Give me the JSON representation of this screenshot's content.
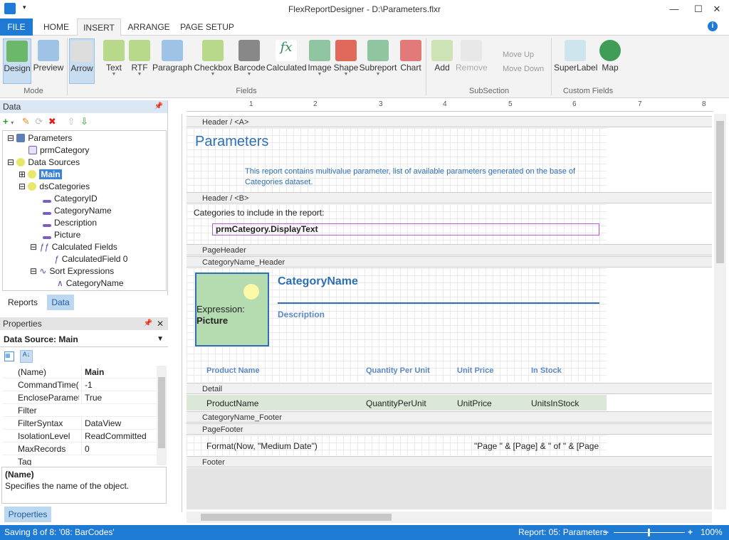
{
  "app": {
    "title": "FlexReportDesigner - D:\\Parameters.flxr"
  },
  "tabs": [
    "FILE",
    "HOME",
    "INSERT",
    "ARRANGE",
    "PAGE SETUP"
  ],
  "ribbon": {
    "mode": [
      "Design",
      "Preview"
    ],
    "fields": [
      "Arrow",
      "Text",
      "RTF",
      "Paragraph",
      "Checkbox",
      "Barcode",
      "Calculated",
      "Image",
      "Shape",
      "Subreport",
      "Chart"
    ],
    "subsection": [
      "Add",
      "Remove",
      "Move Up",
      "Move Down"
    ],
    "custom": [
      "SuperLabel",
      "Map"
    ],
    "groups": {
      "mode": "Mode",
      "fields": "Fields",
      "subsection": "SubSection",
      "custom": "Custom Fields"
    }
  },
  "datapanel": {
    "title": "Data",
    "tree": [
      "Parameters",
      "prmCategory",
      "Data Sources",
      "Main",
      "dsCategories",
      "CategoryID",
      "CategoryName",
      "Description",
      "Picture",
      "Calculated Fields",
      "CalculatedField 0",
      "Sort Expressions",
      "CategoryName"
    ]
  },
  "paneltabs": [
    "Reports",
    "Data"
  ],
  "properties": {
    "title": "Properties",
    "object": "Data Source: Main",
    "rows": [
      [
        "(Name)",
        "Main"
      ],
      [
        "CommandTime(",
        "-1"
      ],
      [
        "EncloseParamete",
        "True"
      ],
      [
        "Filter",
        ""
      ],
      [
        "FilterSyntax",
        "DataView"
      ],
      [
        "IsolationLevel",
        "ReadCommitted"
      ],
      [
        "MaxRecords",
        "0"
      ],
      [
        "Tag",
        ""
      ]
    ],
    "desc_title": "(Name)",
    "desc_text": "Specifies the name of the object.",
    "tab": "Properties"
  },
  "ruler": [
    "1",
    "2",
    "3",
    "4",
    "5",
    "6",
    "7",
    "8"
  ],
  "report": {
    "sections": [
      "Header / <A>",
      "Header / <B>",
      "PageHeader",
      "CategoryName_Header",
      "Detail",
      "CategoryName_Footer",
      "PageFooter",
      "Footer"
    ],
    "title": "Parameters",
    "intro": "This report contains multivalue parameter, list of available parameters generated on the base of Categories dataset.",
    "cat_label": "Categories to include in the report:",
    "cat_expr": "prmCategory.DisplayText",
    "pic_expr1": "Expression:",
    "pic_expr2": "Picture",
    "cat_name": "CategoryName",
    "description": "Description",
    "col_headers": [
      "Product Name",
      "Quantity Per Unit",
      "Unit Price",
      "In Stock"
    ],
    "detail": [
      "ProductName",
      "QuantityPerUnit",
      "UnitPrice",
      "UnitsInStock"
    ],
    "footer_left": "Format(Now, \"Medium Date\")",
    "footer_right": "\"Page \" & [Page] & \" of \" & [Page"
  },
  "status": {
    "left": "Saving 8 of 8: '08: BarCodes'",
    "report": "Report: 05: Parameters",
    "zoom": "100%"
  }
}
